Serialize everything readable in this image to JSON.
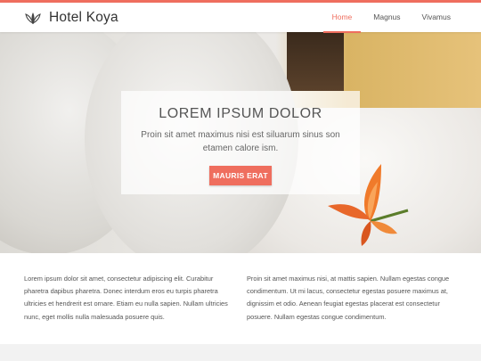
{
  "header": {
    "brand": "Hotel Koya",
    "logo_icon": "lotus-icon",
    "nav": [
      {
        "label": "Home",
        "active": true
      },
      {
        "label": "Magnus",
        "active": false
      },
      {
        "label": "Vivamus",
        "active": false
      }
    ]
  },
  "hero": {
    "title": "LOREM IPSUM DOLOR",
    "subtitle": "Proin sit amet maximus nisi est siluarum sinus son etamen calore ism.",
    "button": "MAURIS ERAT"
  },
  "content": {
    "left": "Lorem ipsum dolor sit amet, consectetur adipiscing elit. Curabitur pharetra dapibus pharetra. Donec interdum eros eu turpis pharetra ultricies et hendrerit est ornare. Etiam eu nulla sapien. Nullam ultricies nunc, eget mollis nulla malesuada posuere quis.",
    "right": "Proin sit amet maximus nisi, at mattis sapien. Nullam egestas congue condimentum. Ut mi lacus, consectetur egestas posuere maximus at, dignissim et odio. Aenean feugiat egestas placerat est consectetur posuere. Nullam egestas congue condimentum."
  },
  "colors": {
    "accent": "#ef6e5e",
    "footer_bg": "#f2f2f2"
  }
}
